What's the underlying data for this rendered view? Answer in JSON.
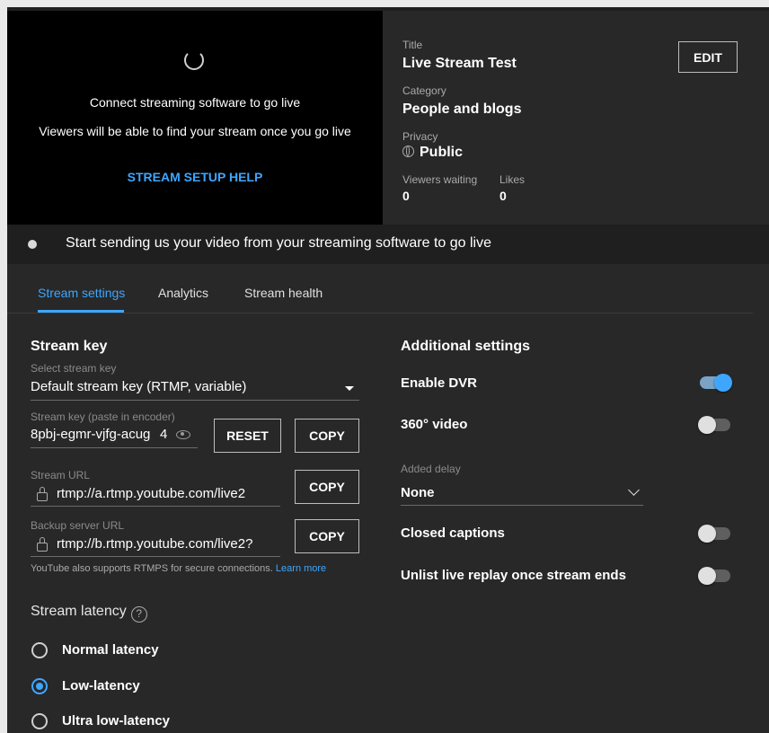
{
  "preview": {
    "connect_text": "Connect streaming software to go live",
    "viewers_text": "Viewers will be able to find your stream once you go live",
    "setup_help": "STREAM SETUP HELP"
  },
  "details": {
    "title_label": "Title",
    "title_value": "Live Stream Test",
    "edit_label": "EDIT",
    "category_label": "Category",
    "category_value": "People and blogs",
    "privacy_label": "Privacy",
    "privacy_value": "Public",
    "viewers_waiting_label": "Viewers waiting",
    "viewers_waiting_value": "0",
    "likes_label": "Likes",
    "likes_value": "0"
  },
  "status": {
    "message": "Start sending us your video from your streaming software to go live"
  },
  "tabs": [
    {
      "label": "Stream settings",
      "active": true
    },
    {
      "label": "Analytics",
      "active": false
    },
    {
      "label": "Stream health",
      "active": false
    }
  ],
  "stream_key": {
    "section_title": "Stream key",
    "select_label": "Select stream key",
    "select_value": "Default stream key (RTMP, variable)",
    "key_label": "Stream key (paste in encoder)",
    "key_value": "8pbj-egmr-vjfg-acug",
    "key_suffix": "4",
    "reset_label": "RESET",
    "copy_label": "COPY",
    "url_label": "Stream URL",
    "url_value": "rtmp://a.rtmp.youtube.com/live2",
    "backup_label": "Backup server URL",
    "backup_value": "rtmp://b.rtmp.youtube.com/live2?",
    "note_text": "YouTube also supports RTMPS for secure connections.",
    "note_link": "Learn more"
  },
  "latency": {
    "section_title": "Stream latency",
    "help_glyph": "?",
    "options": [
      {
        "label": "Normal latency",
        "selected": false
      },
      {
        "label": "Low-latency",
        "selected": true
      },
      {
        "label": "Ultra low-latency",
        "selected": false
      }
    ]
  },
  "additional": {
    "section_title": "Additional settings",
    "dvr_label": "Enable DVR",
    "dvr_on": true,
    "video360_label": "360° video",
    "video360_on": false,
    "delay_label": "Added delay",
    "delay_value": "None",
    "captions_label": "Closed captions",
    "captions_on": false,
    "unlist_label": "Unlist live replay once stream ends",
    "unlist_on": false
  },
  "colors": {
    "accent": "#3ea6ff",
    "panel": "#282828",
    "background": "#1f1f1f"
  }
}
